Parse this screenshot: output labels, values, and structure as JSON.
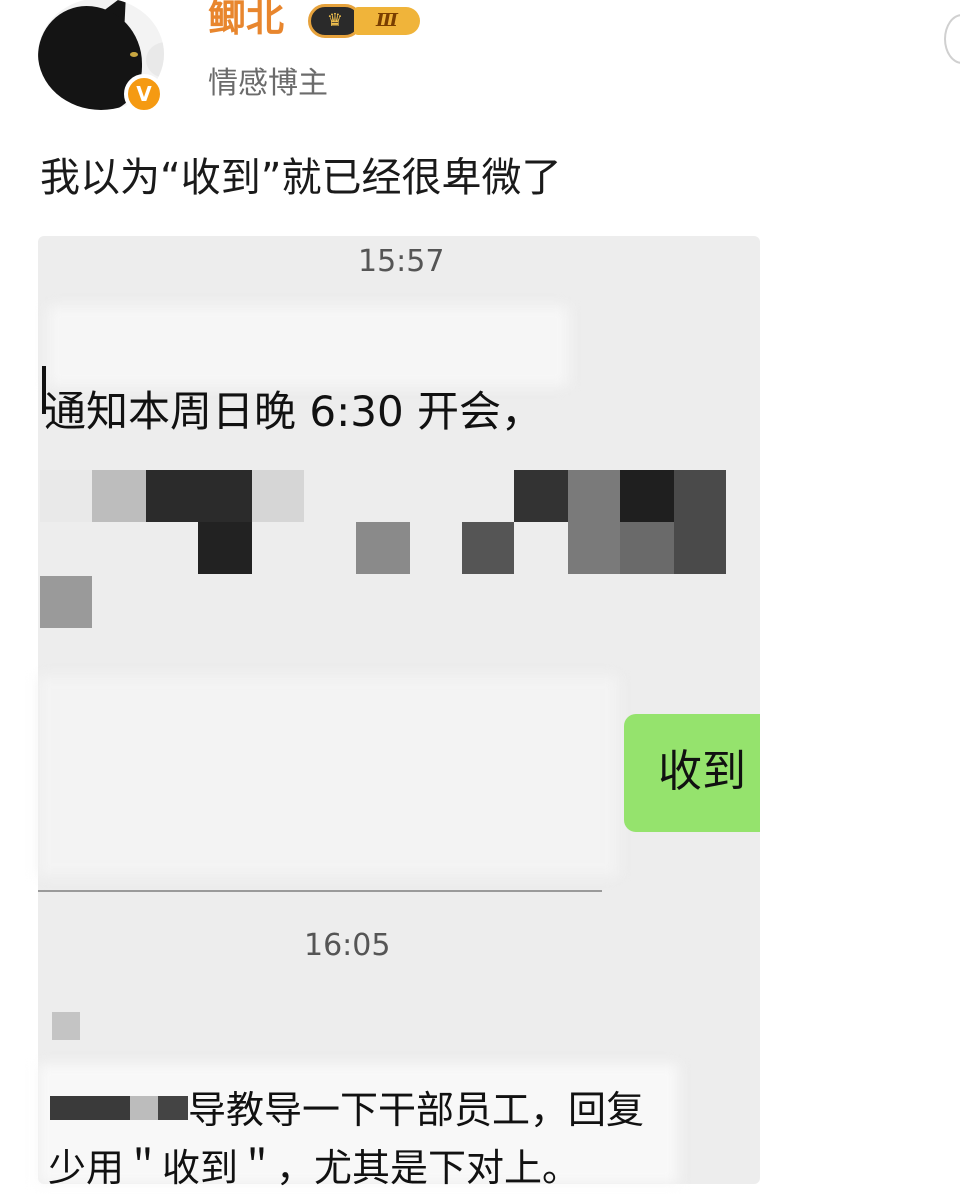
{
  "header": {
    "username": "鲫北",
    "level": "Ⅲ",
    "user_tag": "情感博主",
    "verified_mark": "V"
  },
  "post": {
    "text": "我以为“收到”就已经很卑微了"
  },
  "chat": {
    "messages": [
      {
        "time": "15:57"
      },
      {
        "text": "通知本周日晚 6:30 开会，"
      },
      {
        "reply": "收到"
      },
      {
        "time": "16:05"
      },
      {
        "line1": "导教导一下干部员工，回复",
        "line2": "少用＂收到＂，尤其是下对上。"
      }
    ]
  },
  "icons": {
    "crown": "crown-icon",
    "verified": "verified-badge-icon",
    "follow": "follow-circle-icon"
  },
  "colors": {
    "username": "#e8862e",
    "reply_bubble": "#95e36d",
    "chat_bg": "#ededed",
    "verify_badge": "#f59a12"
  }
}
